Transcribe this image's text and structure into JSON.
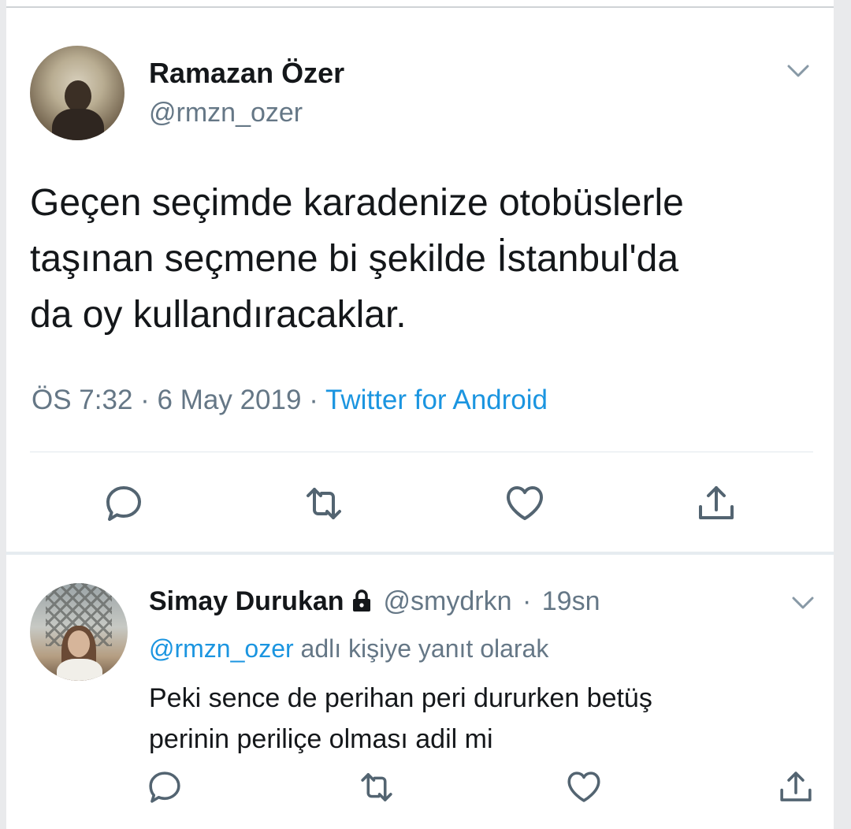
{
  "colors": {
    "text": "#14171a",
    "secondary": "#657786",
    "accent": "#1b95e0",
    "separator": "#e1e8ed"
  },
  "main_tweet": {
    "author_name": "Ramazan Özer",
    "author_handle": "@rmzn_ozer",
    "text": "Geçen seçimde karadenize otobüslerle\ntaşınan seçmene bi şekilde İstanbul'da\nda oy kullandıracaklar.",
    "time": "ÖS 7:32",
    "date": "6 May 2019",
    "separator": "·",
    "source": "Twitter for Android",
    "actions": [
      "reply-icon",
      "retweet-icon",
      "like-icon",
      "share-icon"
    ]
  },
  "reply_tweet": {
    "author_name": "Simay Durukan",
    "author_handle": "@smydrkn",
    "separator": "·",
    "time_ago": "19sn",
    "protected_icon": "lock-icon",
    "replying_to_mention": "@rmzn_ozer",
    "replying_to_suffix": "adlı kişiye yanıt olarak",
    "text": "Peki sence de perihan peri dururken betüş\nperinin periliçe olması adil mi",
    "actions": [
      "reply-icon",
      "retweet-icon",
      "like-icon",
      "share-icon"
    ]
  }
}
